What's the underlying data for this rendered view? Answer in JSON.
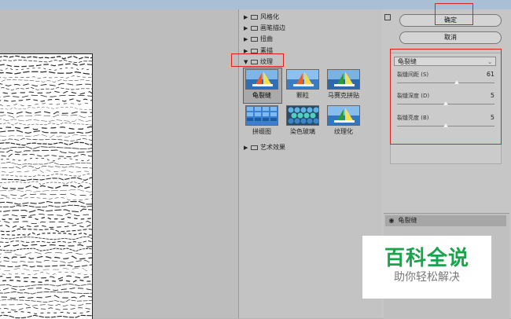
{
  "gallery": {
    "categories": [
      {
        "label": "风格化",
        "expanded": false
      },
      {
        "label": "画笔描边",
        "expanded": false
      },
      {
        "label": "扭曲",
        "expanded": false
      },
      {
        "label": "素描",
        "expanded": false
      },
      {
        "label": "纹理",
        "expanded": true
      },
      {
        "label": "艺术效果",
        "expanded": false
      }
    ],
    "textures": [
      {
        "label": "龟裂缝",
        "selected": true
      },
      {
        "label": "颗粒",
        "selected": false
      },
      {
        "label": "马赛克拼贴",
        "selected": false
      },
      {
        "label": "拼缀图",
        "selected": false
      },
      {
        "label": "染色玻璃",
        "selected": false
      },
      {
        "label": "纹理化",
        "selected": false
      }
    ]
  },
  "buttons": {
    "ok": "确定",
    "cancel": "取消"
  },
  "settings": {
    "filter": "龟裂缝",
    "params": [
      {
        "label": "裂缝间距 (S)",
        "value": "61",
        "fraction": 0.61
      },
      {
        "label": "裂缝深度 (D)",
        "value": "5",
        "fraction": 0.5
      },
      {
        "label": "裂缝亮度 (B)",
        "value": "5",
        "fraction": 0.5
      }
    ]
  },
  "layers": {
    "item": "龟裂缝"
  },
  "watermark": {
    "title": "百科全说",
    "subtitle": "助你轻松解决"
  },
  "colors": {
    "annotation": "#e02020",
    "watermark_green": "#1aa34a"
  }
}
